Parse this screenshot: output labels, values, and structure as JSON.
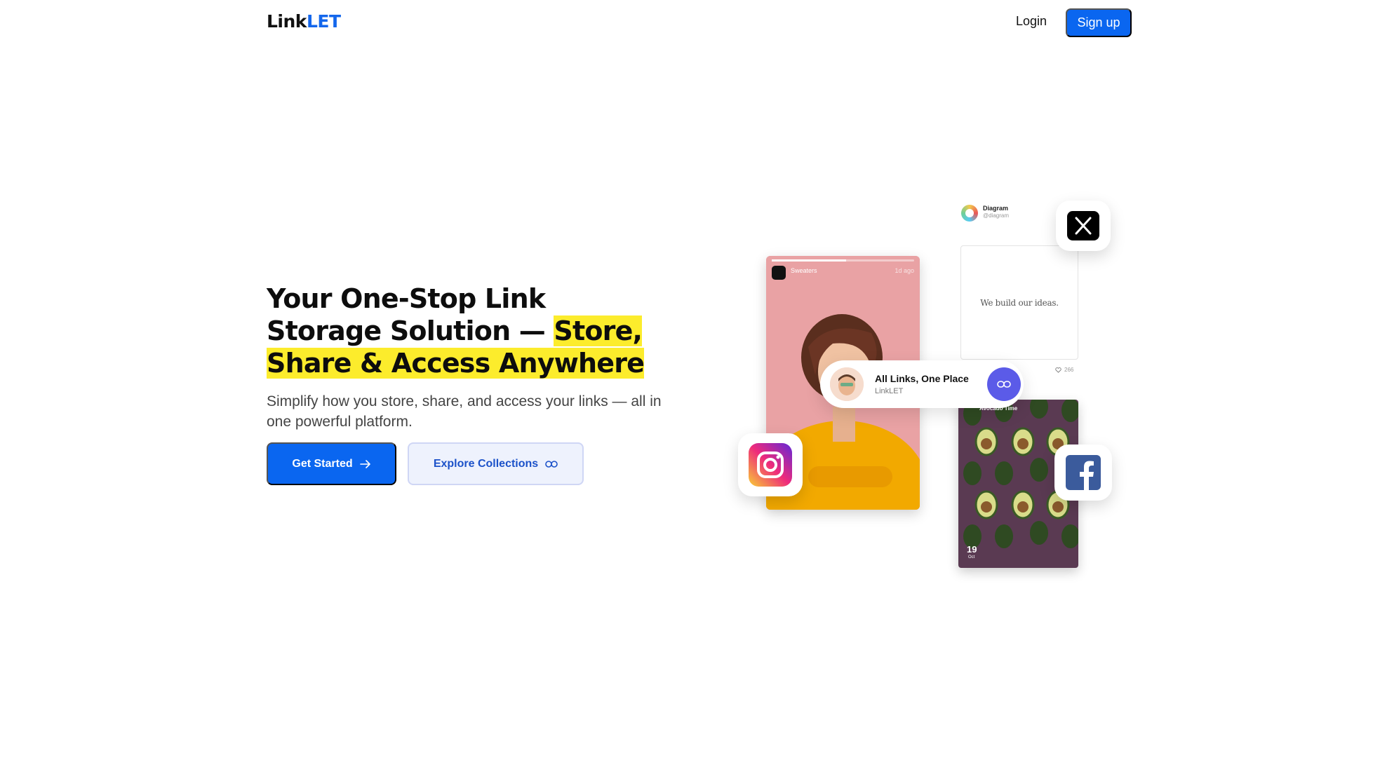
{
  "header": {
    "logo_part1": "Link",
    "logo_part2": "LET",
    "login_label": "Login",
    "signup_label": "Sign up"
  },
  "hero": {
    "title_plain": "Your One-Stop Link Storage Solution — ",
    "title_highlight": "Store, Share & Access Anywhere",
    "subtitle": "Simplify how you store, share, and access your links — all in one powerful platform.",
    "primary_button": "Get Started",
    "secondary_button": "Explore Collections"
  },
  "illustration": {
    "story": {
      "name": "Sweaters",
      "time": "1d ago",
      "progress": 0.52
    },
    "post": {
      "account": "Diagram",
      "handle": "@diagram",
      "text": "We build our ideas.",
      "likes": "266"
    },
    "avocado": {
      "title": "Avocado Time",
      "day": "19",
      "month": "Oct"
    },
    "pill": {
      "title": "All Links, One Place",
      "subtitle": "LinkLET"
    },
    "social_icons": [
      "x-icon",
      "instagram-icon",
      "facebook-icon"
    ]
  },
  "colors": {
    "brand_blue": "#0a66f0",
    "highlight_yellow": "#fcec2c",
    "pill_button": "#5b5be8"
  }
}
